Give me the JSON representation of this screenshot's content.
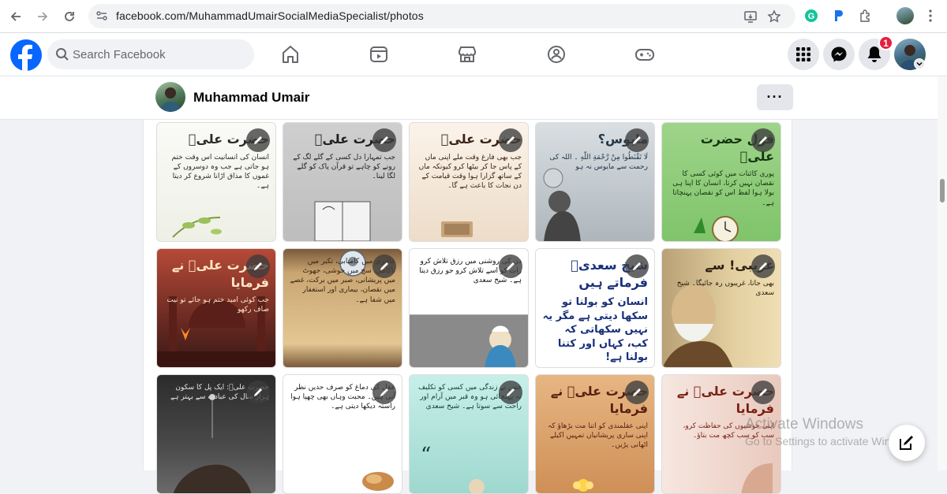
{
  "browser": {
    "url": "facebook.com/MuhammadUmairSocialMediaSpecialist/photos",
    "back_icon": "arrow-left-icon",
    "forward_icon": "arrow-right-icon",
    "reload_icon": "reload-icon"
  },
  "header": {
    "search_placeholder": "Search Facebook",
    "notification_count": "1",
    "brand_color": "#0866ff"
  },
  "profile": {
    "name": "Muhammad Umair",
    "more_label": "···"
  },
  "photos": [
    {
      "heading": "حضرت علیؑ",
      "body": "انسان کی انسانیت اس وقت ختم ہو جاتی ہے جب وہ دوسروں کے غموں کا مذاق اڑانا شروع کر دیتا ہے۔"
    },
    {
      "heading": "حضرت علیؑ",
      "body": "جب تمہارا دل کسی کے گلے لگ کے رونے کو چاہے تو قرآن پاک کو گلے لگا لینا۔"
    },
    {
      "heading": "حضرت علیؑ",
      "body": "جب بھی فارغ وقت ملے اپنی ماں کے پاس جا کر بیٹھا کرو کیونکہ ماں کے ساتھ گزارا ہوا وقت قیامت کے دن نجات کا باعث ہے گا۔"
    },
    {
      "heading": "مایوس؟",
      "body": "لَا تَقْنَطُوا مِنْ رَّحْمَةِ اللّٰهِ ۔ اللہ کی رحمت سے مایوس نہ ہو"
    },
    {
      "heading": "قول حضرت علیؑ",
      "body": "پوری کائنات میں کوئی کسی کا نقصان نہیں کرتا، انسان کا اپنا ہی بولا ہوا لفظ اس کو نقصان پہنچاتا ہے۔"
    },
    {
      "heading": "حضرت علیؑ نے فرمایا",
      "body": "جب کوئی امید ختم ہو جائے تو نیت صاف رکھو"
    },
    {
      "heading": "",
      "body": "عاجزی میں کامیابی، تکبر میں ناکامی، سچ میں خوشی، جھوٹ میں پریشانی، صبر میں برکت، غصے میں نقصان، بیماری اور استغفار میں شفا ہے۔"
    },
    {
      "heading": "",
      "body": "دن کی روشنی میں رزق تلاش کرو رات کو اسے تلاش کرو جو رزق دیتا ہے۔ شیخ سعدی"
    },
    {
      "heading": "شیخ سعدیؒ فرماتے ہیں",
      "body": "انسان کو بولنا تو سکھا دیتی ہے مگر یہ نہیں سکھاتی کہ کب، کہاں اور کتنا بولنا ہے!"
    },
    {
      "heading": "غریبی! سے",
      "body": "بھی جاتا، غریبوں رہ جائیگا۔ شیخ سعدی"
    },
    {
      "heading": "",
      "body": "حضرت علیؑ: ایک پل کا سکون ہزار سال کی عبادت سے بہتر ہے"
    },
    {
      "heading": "",
      "body": "عقل کی دماغ کو صرف حدیں نظر آتی ہیں۔ محبت وہاں بھی چھپا ہوا راستہ دیکھا دیتی ہے۔"
    },
    {
      "heading": "",
      "body": "جس نے زندگی میں کسی کو تکلیف نہ پہنچائی ہو وہ قبر میں آرام اور راحت سے سوتا ہے۔ شیخ سعدی"
    },
    {
      "heading": "حضرت علیؑ نے فرمایا",
      "body": "اپنی عقلمندی کو اتنا مت بڑھاؤ کہ اپنی ساری پریشانیاں تمہیں اکیلے اٹھانی پڑیں۔"
    },
    {
      "heading": "حضرت علیؑ نے فرمایا",
      "body": "اپنی خوشیوں کی حفاظت کرو، سب کو سب کچھ مت بتاؤ۔"
    }
  ],
  "watermark": {
    "line1": "Activate Windows",
    "line2": "Go to Settings to activate Windows."
  },
  "colors": {
    "accent": "#0866ff",
    "badge": "#e41e3f"
  }
}
